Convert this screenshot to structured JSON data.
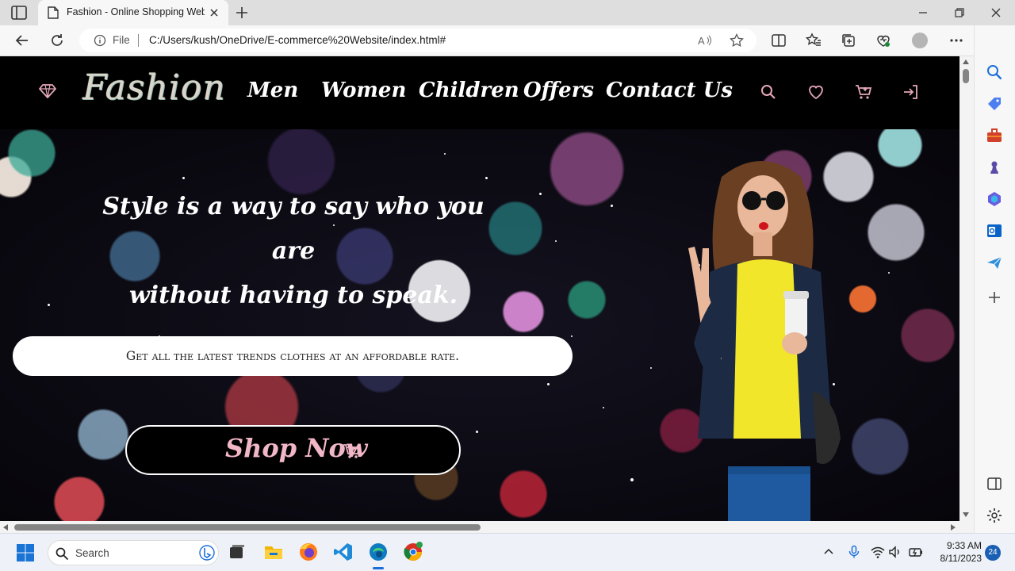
{
  "browser": {
    "tab_title": "Fashion - Online Shopping Website",
    "address": {
      "scheme_label": "File",
      "url": "C:/Users/kush/OneDrive/E-commerce%20Website/index.html#"
    }
  },
  "site": {
    "logo": "Fashion",
    "nav": [
      "Men",
      "Women",
      "Children",
      "Offers",
      "Contact Us"
    ],
    "header_icons": [
      "search-icon",
      "heart-icon",
      "cart-icon",
      "login-icon"
    ]
  },
  "hero": {
    "tagline_line1": "Style is a way to say who you are",
    "tagline_line2": "without having to speak.",
    "subtitle": "Get all the latest trends clothes at an affordable rate.",
    "cta": "Shop Now"
  },
  "taskbar": {
    "search_placeholder": "Search",
    "time": "9:33 AM",
    "date": "8/11/2023",
    "notifications": "24"
  },
  "colors": {
    "header_bg": "#000000",
    "accent_pink": "#f1b7c6",
    "accent_icon": "#e6a8b8"
  }
}
